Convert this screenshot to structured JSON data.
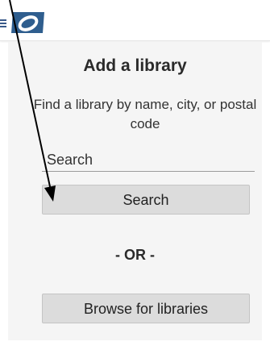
{
  "header": {
    "menu_icon": "hamburger-menu-icon",
    "logo_icon": "app-logo-icon"
  },
  "main": {
    "title": "Add a library",
    "description": "Find a library by name, city, or postal code",
    "search": {
      "placeholder": "Search",
      "value": ""
    },
    "search_button_label": "Search",
    "or_label": "- OR -",
    "browse_button_label": "Browse for libraries"
  },
  "colors": {
    "logo_blue": "#2f5e8e",
    "button_bg": "#dcdcdc",
    "panel_bg": "#f5f5f5"
  }
}
